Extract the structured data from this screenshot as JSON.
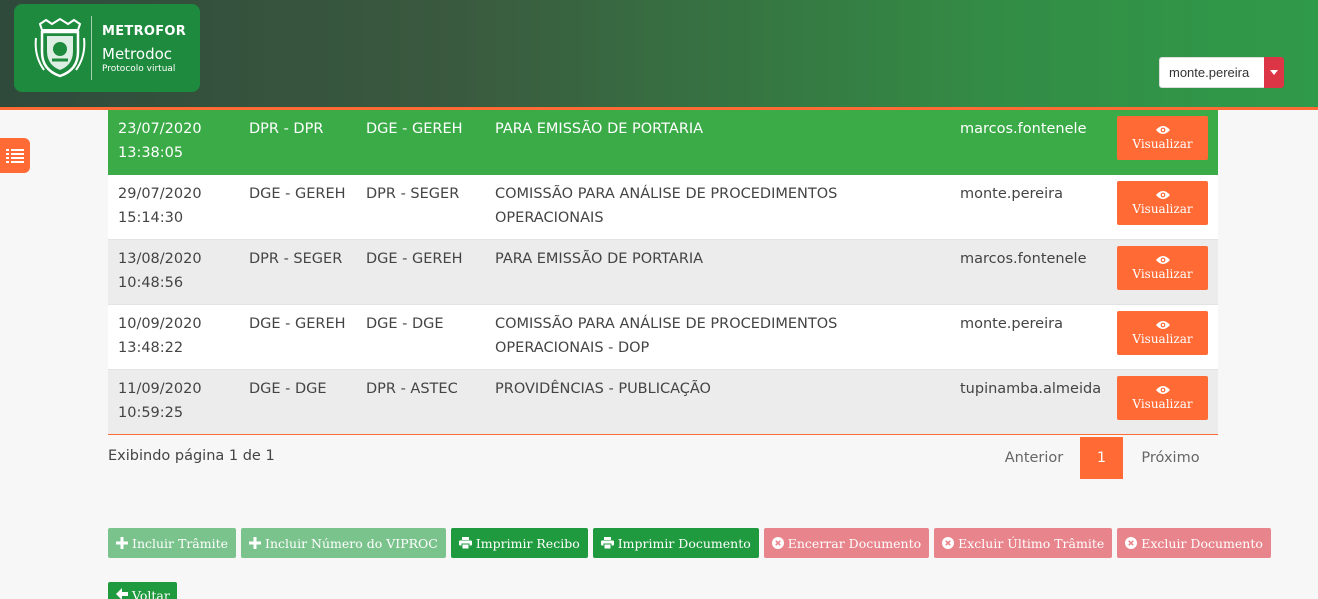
{
  "header": {
    "brand": "METROFOR",
    "app_name": "Metrodoc",
    "app_subtitle": "Protocolo virtual",
    "user": "monte.pereira"
  },
  "table": {
    "rows": [
      {
        "date": "23/07/2020",
        "time": "13:38:05",
        "from": "DPR - DPR",
        "to": "DGE - GEREH",
        "desc": "PARA EMISSÃO DE PORTARIA",
        "user": "marcos.fontenele",
        "action": "Visualizar"
      },
      {
        "date": "29/07/2020",
        "time": "15:14:30",
        "from": "DGE - GEREH",
        "to": "DPR - SEGER",
        "desc": "COMISSÃO PARA ANÁLISE DE PROCEDIMENTOS OPERACIONAIS",
        "user": "monte.pereira",
        "action": "Visualizar"
      },
      {
        "date": "13/08/2020",
        "time": "10:48:56",
        "from": "DPR - SEGER",
        "to": "DGE - GEREH",
        "desc": "PARA EMISSÃO DE PORTARIA",
        "user": "marcos.fontenele",
        "action": "Visualizar"
      },
      {
        "date": "10/09/2020",
        "time": "13:48:22",
        "from": "DGE - GEREH",
        "to": "DGE - DGE",
        "desc": "COMISSÃO PARA ANÁLISE DE PROCEDIMENTOS OPERACIONAIS - DOP",
        "user": "monte.pereira",
        "action": "Visualizar"
      },
      {
        "date": "11/09/2020",
        "time": "10:59:25",
        "from": "DGE - DGE",
        "to": "DPR - ASTEC",
        "desc": "PROVIDÊNCIAS - PUBLICAÇÃO",
        "user": "tupinamba.almeida",
        "action": "Visualizar"
      }
    ]
  },
  "pagination": {
    "info": "Exibindo página 1 de 1",
    "prev": "Anterior",
    "current": "1",
    "next": "Próximo"
  },
  "actions": {
    "incluir_tramite": "Incluir Trâmite",
    "incluir_viproc": "Incluir Número do VIPROC",
    "imprimir_recibo": "Imprimir Recibo",
    "imprimir_documento": "Imprimir Documento",
    "encerrar_documento": "Encerrar Documento",
    "excluir_ultimo_tramite": "Excluir Último Trâmite",
    "excluir_documento": "Excluir Documento",
    "voltar": "Voltar"
  },
  "colors": {
    "accent": "#ff6a35",
    "highlight_row": "#3aab47",
    "green_dark": "#1f9a3f",
    "green_light": "#7bc38c",
    "red_light": "#e8848b"
  }
}
